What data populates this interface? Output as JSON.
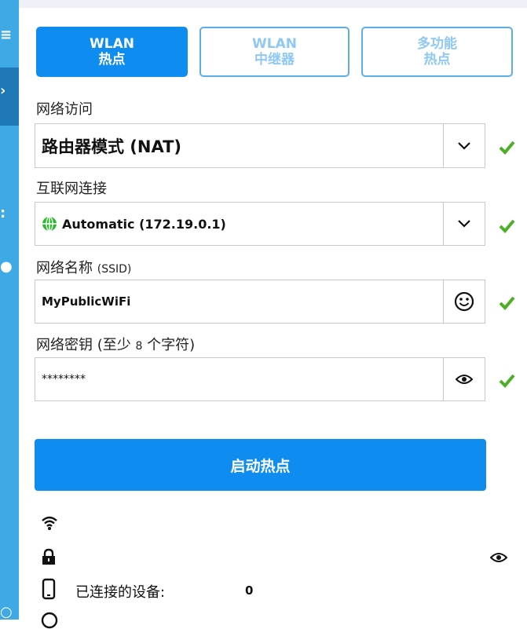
{
  "tabs": [
    {
      "line1": "WLAN",
      "line2": "热点",
      "active": true
    },
    {
      "line1": "WLAN",
      "line2": "中继器",
      "active": false
    },
    {
      "line1": "多功能",
      "line2": "热点",
      "active": false
    }
  ],
  "network_access": {
    "label": "网络访问",
    "value": "路由器模式 (NAT)"
  },
  "internet": {
    "label": "互联网连接",
    "value": "Automatic (172.19.0.1)"
  },
  "ssid": {
    "label_main": "网络名称 ",
    "label_small": "(SSID)",
    "value": "MyPublicWiFi"
  },
  "password": {
    "label_main": "网络密钥 (至少 ",
    "label_small": "8",
    "label_end": " 个字符)",
    "value": "********"
  },
  "start_button": "启动热点",
  "status": {
    "connected_label": "已连接的设备:",
    "connected_count": "0"
  },
  "colors": {
    "accent": "#0e8cef",
    "sidebar": "#3fa9e6",
    "check": "#4caf24"
  }
}
